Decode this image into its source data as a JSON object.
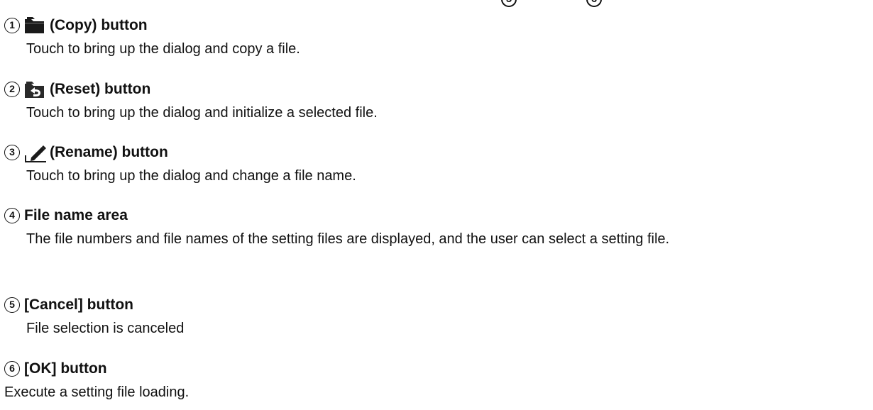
{
  "top_markers": [
    "5",
    "6"
  ],
  "items": [
    {
      "number": "1",
      "icon": "folder-icon",
      "title": "(Copy) button",
      "desc": "Touch to bring up the dialog and copy a file."
    },
    {
      "number": "2",
      "icon": "reset-icon",
      "title": "(Reset) button",
      "desc": "Touch to bring up the dialog and initialize a selected file."
    },
    {
      "number": "3",
      "icon": "pencil-icon",
      "title": "(Rename) button",
      "desc": "Touch to bring up the dialog and change a file name."
    },
    {
      "number": "4",
      "icon": "",
      "title": "File name area",
      "desc": "The file numbers and file names of the setting files are displayed, and the user can select a setting file."
    },
    {
      "number": "5",
      "icon": "",
      "title": "[Cancel] button",
      "desc": "File selection is canceled"
    },
    {
      "number": "6",
      "icon": "",
      "title": "[OK] button",
      "desc": "Execute a setting file loading."
    }
  ]
}
